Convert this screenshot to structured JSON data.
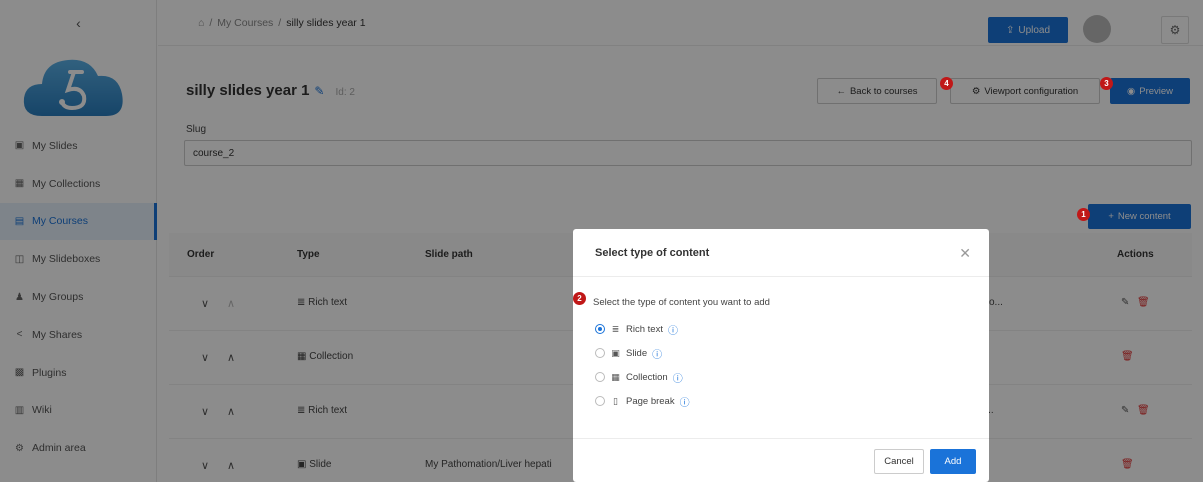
{
  "sidebar": {
    "collapse_icon": "chevron-left-icon",
    "items": [
      {
        "label": "My Slides",
        "icon": "▣"
      },
      {
        "label": "My Collections",
        "icon": "▦"
      },
      {
        "label": "My Courses",
        "icon": "▤",
        "active": true
      },
      {
        "label": "My Slideboxes",
        "icon": "◫"
      },
      {
        "label": "My Groups",
        "icon": "♟"
      },
      {
        "label": "My Shares",
        "icon": "<"
      },
      {
        "label": "Plugins",
        "icon": "▩"
      },
      {
        "label": "Wiki",
        "icon": "▥"
      },
      {
        "label": "Admin area",
        "icon": "⚙"
      }
    ]
  },
  "header": {
    "breadcrumb": {
      "home_icon": "⌂",
      "sep": "/",
      "courses": "My Courses",
      "current": "silly slides year 1"
    },
    "upload_label": "Upload",
    "upload_icon": "⇪",
    "settings_icon": "⚙"
  },
  "course": {
    "title": "silly slides year 1",
    "id_label": "Id: 2",
    "slug_label": "Slug",
    "slug_value": "course_2"
  },
  "toolbar": {
    "back_label": "Back to courses",
    "back_icon": "←",
    "viewport_label": "Viewport configuration",
    "viewport_icon": "⚙",
    "preview_label": "Preview",
    "preview_icon": "◉",
    "new_content_label": "New content",
    "new_content_icon": "+"
  },
  "table": {
    "headers": {
      "order": "Order",
      "type": "Type",
      "slide_path": "Slide path",
      "actions": "Actions"
    },
    "rows": [
      {
        "type": "Rich text",
        "type_icon": "≣",
        "path": "",
        "trunc": "o...",
        "up_disabled": true,
        "editable": true
      },
      {
        "type": "Collection",
        "type_icon": "▦",
        "path": "",
        "trunc": "",
        "up_disabled": false,
        "editable": false
      },
      {
        "type": "Rich text",
        "type_icon": "≣",
        "path": "",
        "trunc": "nt...",
        "up_disabled": false,
        "editable": true
      },
      {
        "type": "Slide",
        "type_icon": "▣",
        "path": "My Pathomation/Liver hepati",
        "trunc": "",
        "up_disabled": false,
        "editable": false
      }
    ]
  },
  "modal": {
    "title": "Select type of content",
    "close_icon": "✕",
    "prompt": "Select the type of content you want to add",
    "options": [
      {
        "label": "Rich text",
        "icon": "≣",
        "selected": true
      },
      {
        "label": "Slide",
        "icon": "▣",
        "selected": false
      },
      {
        "label": "Collection",
        "icon": "▦",
        "selected": false
      },
      {
        "label": "Page break",
        "icon": "▯",
        "selected": false
      }
    ],
    "help_icon": "ⓘ",
    "cancel_label": "Cancel",
    "add_label": "Add"
  },
  "markers": {
    "m1": "1",
    "m2": "2",
    "m3": "3",
    "m4": "4"
  }
}
